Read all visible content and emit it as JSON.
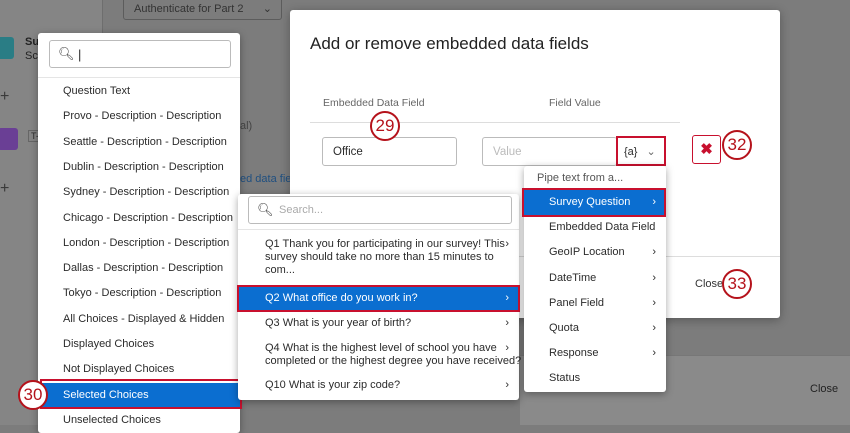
{
  "background": {
    "top_select": "Authenticate for Part 2",
    "sidebar_text_1": "Su",
    "sidebar_text_2": "Sc",
    "sidebar_tag": "T-",
    "partial_label": "al)",
    "partial_link": "ed data fie",
    "bottom_close": "Close"
  },
  "modal": {
    "title": "Add or remove embedded data fields",
    "col_field": "Embedded Data Field",
    "col_value": "Field Value",
    "field_value": "Office",
    "value_placeholder": "Value",
    "piped_text_button": "{a}",
    "close": "Close"
  },
  "annotations": {
    "a29": "29",
    "a30": "30",
    "a32": "32",
    "a33": "33"
  },
  "left_menu": {
    "search_value": "|",
    "items": [
      "Question Text",
      "Provo - Description - Description",
      "Seattle - Description - Description",
      "Dublin - Description - Description",
      "Sydney - Description - Description",
      "Chicago - Description - Description",
      "London - Description - Description",
      "Dallas - Description - Description",
      "Tokyo - Description - Description",
      "All Choices - Displayed & Hidden",
      "Displayed Choices",
      "Not Displayed Choices",
      "Selected Choices",
      "Unselected Choices"
    ],
    "selected_index": 12
  },
  "question_menu": {
    "search_placeholder": "Search...",
    "items": [
      {
        "line1": "Q1 Thank you for participating in our survey! This",
        "line2": "survey should take no more than 15 minutes to",
        "line3": "com..."
      },
      {
        "line1": "Q2 What office do you work in?"
      },
      {
        "line1": "Q3 What is your year of birth?"
      },
      {
        "line1": "Q4 What is the highest level of school you have",
        "line2": "completed or the highest degree you have received?"
      },
      {
        "line1": "Q10 What is your zip code?"
      }
    ],
    "selected_index": 1
  },
  "pipe_menu": {
    "header": "Pipe text from a...",
    "items": [
      "Survey Question",
      "Embedded Data Field",
      "GeoIP Location",
      "DateTime",
      "Panel Field",
      "Quota",
      "Response",
      "Status"
    ],
    "selected_index": 0
  },
  "colors": {
    "accent": "#0b6ed0",
    "annotation": "#b5121b"
  }
}
